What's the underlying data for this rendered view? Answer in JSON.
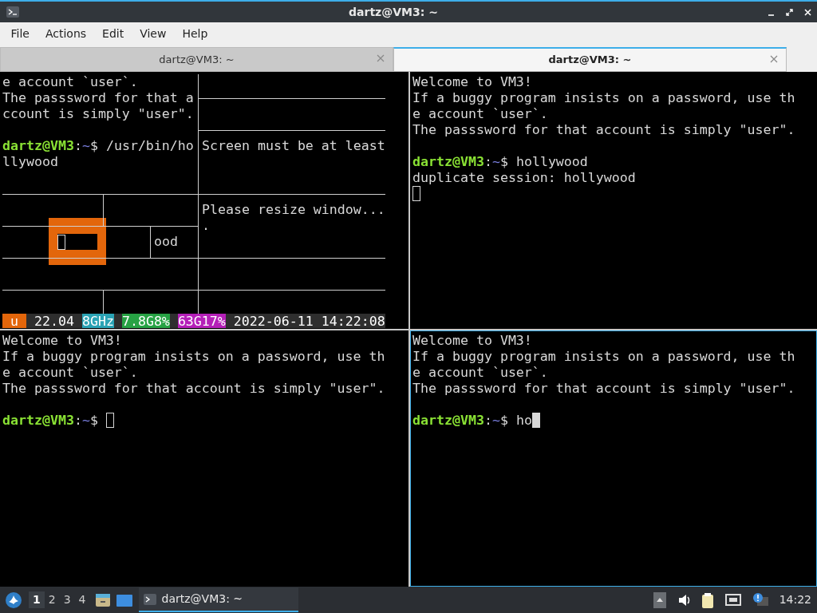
{
  "window": {
    "title": "dartz@VM3: ~"
  },
  "menu": [
    "File",
    "Actions",
    "Edit",
    "View",
    "Help"
  ],
  "tabs": [
    {
      "label": "dartz@VM3: ~",
      "selected": false
    },
    {
      "label": "dartz@VM3: ~",
      "selected": true
    }
  ],
  "panes": [
    {
      "kind": "hollywood",
      "active": false,
      "left_lines": [
        {
          "kind": "text",
          "text": "e account `user`."
        },
        {
          "kind": "text",
          "text": "The passsword for that a"
        },
        {
          "kind": "text",
          "text": "ccount is simply \"user\"."
        },
        {
          "kind": "blank"
        },
        {
          "kind": "prompt",
          "user": "dartz@VM3",
          "sep": ":",
          "path": "~",
          "sign": "$",
          "command": "/usr/bin/ho"
        },
        {
          "kind": "text",
          "text": "llywood"
        }
      ],
      "right_texts": [
        "Screen must be at least",
        "Please resize window...",
        "."
      ],
      "fragment": "ood",
      "status": [
        {
          "text": "u",
          "color": "#e3660b"
        },
        {
          "text": "22.04",
          "color": "#2e2e2e"
        },
        {
          "text": "8GHz",
          "color": "#2aa3b5"
        },
        {
          "text": "7.8G8%",
          "color": "#27a244"
        },
        {
          "text": "63G17%",
          "color": "#b51fb8"
        },
        {
          "text": "2022-06-11 14:22:08",
          "color": "#2e2e2e"
        }
      ]
    },
    {
      "kind": "shell",
      "active": false,
      "lines": [
        {
          "kind": "text",
          "text": "Welcome to VM3!"
        },
        {
          "kind": "text",
          "text": "If a buggy program insists on a password, use th"
        },
        {
          "kind": "text",
          "text": "e account `user`."
        },
        {
          "kind": "text",
          "text": "The passsword for that account is simply \"user\"."
        },
        {
          "kind": "blank"
        },
        {
          "kind": "prompt",
          "user": "dartz@VM3",
          "sep": ":",
          "path": "~",
          "sign": "$",
          "command": "hollywood"
        },
        {
          "kind": "text",
          "text": "duplicate session: hollywood"
        },
        {
          "kind": "cursor",
          "focused": false
        }
      ]
    },
    {
      "kind": "shell",
      "active": false,
      "lines": [
        {
          "kind": "text",
          "text": "Welcome to VM3!"
        },
        {
          "kind": "text",
          "text": "If a buggy program insists on a password, use th"
        },
        {
          "kind": "text",
          "text": "e account `user`."
        },
        {
          "kind": "text",
          "text": "The passsword for that account is simply \"user\"."
        },
        {
          "kind": "blank"
        },
        {
          "kind": "prompt",
          "user": "dartz@VM3",
          "sep": ":",
          "path": "~",
          "sign": "$",
          "cursor_focused": false
        }
      ]
    },
    {
      "kind": "shell",
      "active": true,
      "lines": [
        {
          "kind": "text",
          "text": "Welcome to VM3!"
        },
        {
          "kind": "text",
          "text": "If a buggy program insists on a password, use th"
        },
        {
          "kind": "text",
          "text": "e account `user`."
        },
        {
          "kind": "text",
          "text": "The passsword for that account is simply \"user\"."
        },
        {
          "kind": "blank"
        },
        {
          "kind": "prompt",
          "user": "dartz@VM3",
          "sep": ":",
          "path": "~",
          "sign": "$",
          "command": "ho",
          "cursor_focused": true
        }
      ]
    }
  ],
  "taskbar": {
    "workspaces": [
      {
        "label": "1",
        "selected": true
      },
      {
        "label": "2",
        "selected": false
      },
      {
        "label": "3",
        "selected": false
      },
      {
        "label": "4",
        "selected": false
      }
    ],
    "tasks": [
      {
        "label": "dartz@VM3: ~",
        "selected": true
      }
    ],
    "clock": "14:22"
  }
}
